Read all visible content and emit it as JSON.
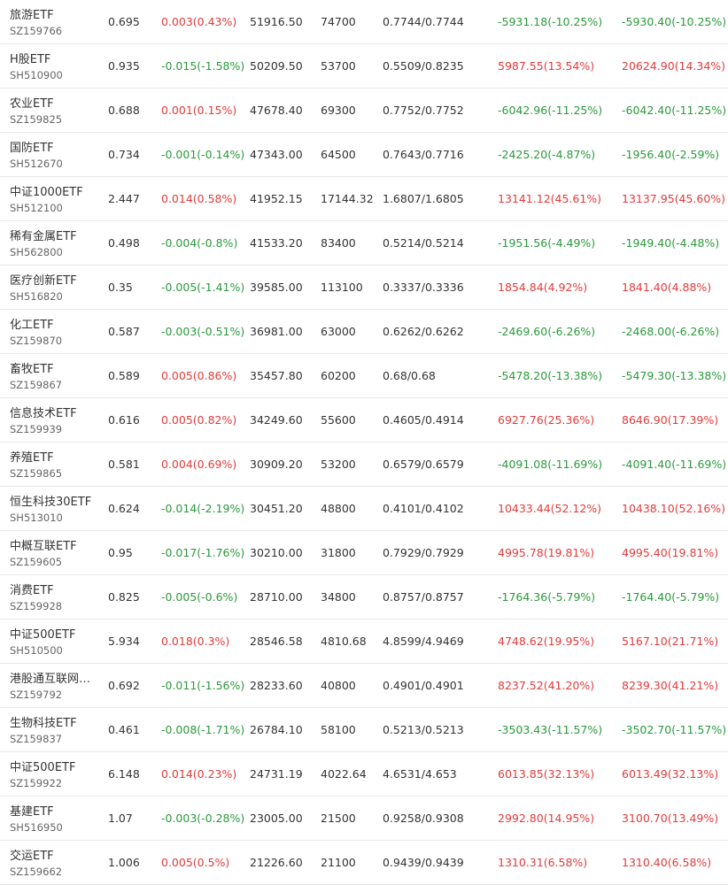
{
  "colors": {
    "up": "#e33b3b",
    "down": "#2a9a3c"
  },
  "rows": [
    {
      "name": "旅游ETF",
      "code": "SZ159766",
      "price": "0.695",
      "change": "0.003(0.43%)",
      "change_dir": "up",
      "market_value": "51916.50",
      "quantity": "74700",
      "cost": "0.7744/0.7744",
      "profit": "-5931.18(-10.25%)",
      "profit_dir": "down",
      "profit2": "-5930.40(-10.25%)",
      "profit2_dir": "down"
    },
    {
      "name": "H股ETF",
      "code": "SH510900",
      "price": "0.935",
      "change": "-0.015(-1.58%)",
      "change_dir": "down",
      "market_value": "50209.50",
      "quantity": "53700",
      "cost": "0.5509/0.8235",
      "profit": "5987.55(13.54%)",
      "profit_dir": "up",
      "profit2": "20624.90(14.34%)",
      "profit2_dir": "up"
    },
    {
      "name": "农业ETF",
      "code": "SZ159825",
      "price": "0.688",
      "change": "0.001(0.15%)",
      "change_dir": "up",
      "market_value": "47678.40",
      "quantity": "69300",
      "cost": "0.7752/0.7752",
      "profit": "-6042.96(-11.25%)",
      "profit_dir": "down",
      "profit2": "-6042.40(-11.25%)",
      "profit2_dir": "down"
    },
    {
      "name": "国防ETF",
      "code": "SH512670",
      "price": "0.734",
      "change": "-0.001(-0.14%)",
      "change_dir": "down",
      "market_value": "47343.00",
      "quantity": "64500",
      "cost": "0.7643/0.7716",
      "profit": "-2425.20(-4.87%)",
      "profit_dir": "down",
      "profit2": "-1956.40(-2.59%)",
      "profit2_dir": "down"
    },
    {
      "name": "中证1000ETF",
      "code": "SH512100",
      "price": "2.447",
      "change": "0.014(0.58%)",
      "change_dir": "up",
      "market_value": "41952.15",
      "quantity": "17144.32",
      "cost": "1.6807/1.6805",
      "profit": "13141.12(45.61%)",
      "profit_dir": "up",
      "profit2": "13137.95(45.60%)",
      "profit2_dir": "up"
    },
    {
      "name": "稀有金属ETF",
      "code": "SH562800",
      "price": "0.498",
      "change": "-0.004(-0.8%)",
      "change_dir": "down",
      "market_value": "41533.20",
      "quantity": "83400",
      "cost": "0.5214/0.5214",
      "profit": "-1951.56(-4.49%)",
      "profit_dir": "down",
      "profit2": "-1949.40(-4.48%)",
      "profit2_dir": "down"
    },
    {
      "name": "医疗创新ETF",
      "code": "SH516820",
      "price": "0.35",
      "change": "-0.005(-1.41%)",
      "change_dir": "down",
      "market_value": "39585.00",
      "quantity": "113100",
      "cost": "0.3337/0.3336",
      "profit": "1854.84(4.92%)",
      "profit_dir": "up",
      "profit2": "1841.40(4.88%)",
      "profit2_dir": "up"
    },
    {
      "name": "化工ETF",
      "code": "SZ159870",
      "price": "0.587",
      "change": "-0.003(-0.51%)",
      "change_dir": "down",
      "market_value": "36981.00",
      "quantity": "63000",
      "cost": "0.6262/0.6262",
      "profit": "-2469.60(-6.26%)",
      "profit_dir": "down",
      "profit2": "-2468.00(-6.26%)",
      "profit2_dir": "down"
    },
    {
      "name": "畜牧ETF",
      "code": "SZ159867",
      "price": "0.589",
      "change": "0.005(0.86%)",
      "change_dir": "up",
      "market_value": "35457.80",
      "quantity": "60200",
      "cost": "0.68/0.68",
      "profit": "-5478.20(-13.38%)",
      "profit_dir": "down",
      "profit2": "-5479.30(-13.38%)",
      "profit2_dir": "down"
    },
    {
      "name": "信息技术ETF",
      "code": "SZ159939",
      "price": "0.616",
      "change": "0.005(0.82%)",
      "change_dir": "up",
      "market_value": "34249.60",
      "quantity": "55600",
      "cost": "0.4605/0.4914",
      "profit": "6927.76(25.36%)",
      "profit_dir": "up",
      "profit2": "8646.90(17.39%)",
      "profit2_dir": "up"
    },
    {
      "name": "养殖ETF",
      "code": "SZ159865",
      "price": "0.581",
      "change": "0.004(0.69%)",
      "change_dir": "up",
      "market_value": "30909.20",
      "quantity": "53200",
      "cost": "0.6579/0.6579",
      "profit": "-4091.08(-11.69%)",
      "profit_dir": "down",
      "profit2": "-4091.40(-11.69%)",
      "profit2_dir": "down"
    },
    {
      "name": "恒生科技30ETF",
      "code": "SH513010",
      "price": "0.624",
      "change": "-0.014(-2.19%)",
      "change_dir": "down",
      "market_value": "30451.20",
      "quantity": "48800",
      "cost": "0.4101/0.4102",
      "profit": "10433.44(52.12%)",
      "profit_dir": "up",
      "profit2": "10438.10(52.16%)",
      "profit2_dir": "up"
    },
    {
      "name": "中概互联ETF",
      "code": "SZ159605",
      "price": "0.95",
      "change": "-0.017(-1.76%)",
      "change_dir": "down",
      "market_value": "30210.00",
      "quantity": "31800",
      "cost": "0.7929/0.7929",
      "profit": "4995.78(19.81%)",
      "profit_dir": "up",
      "profit2": "4995.40(19.81%)",
      "profit2_dir": "up"
    },
    {
      "name": "消费ETF",
      "code": "SZ159928",
      "price": "0.825",
      "change": "-0.005(-0.6%)",
      "change_dir": "down",
      "market_value": "28710.00",
      "quantity": "34800",
      "cost": "0.8757/0.8757",
      "profit": "-1764.36(-5.79%)",
      "profit_dir": "down",
      "profit2": "-1764.40(-5.79%)",
      "profit2_dir": "down"
    },
    {
      "name": "中证500ETF",
      "code": "SH510500",
      "price": "5.934",
      "change": "0.018(0.3%)",
      "change_dir": "up",
      "market_value": "28546.58",
      "quantity": "4810.68",
      "cost": "4.8599/4.9469",
      "profit": "4748.62(19.95%)",
      "profit_dir": "up",
      "profit2": "5167.10(21.71%)",
      "profit2_dir": "up"
    },
    {
      "name": "港股通互联网…",
      "code": "SZ159792",
      "price": "0.692",
      "change": "-0.011(-1.56%)",
      "change_dir": "down",
      "market_value": "28233.60",
      "quantity": "40800",
      "cost": "0.4901/0.4901",
      "profit": "8237.52(41.20%)",
      "profit_dir": "up",
      "profit2": "8239.30(41.21%)",
      "profit2_dir": "up"
    },
    {
      "name": "生物科技ETF",
      "code": "SZ159837",
      "price": "0.461",
      "change": "-0.008(-1.71%)",
      "change_dir": "down",
      "market_value": "26784.10",
      "quantity": "58100",
      "cost": "0.5213/0.5213",
      "profit": "-3503.43(-11.57%)",
      "profit_dir": "down",
      "profit2": "-3502.70(-11.57%)",
      "profit2_dir": "down"
    },
    {
      "name": "中证500ETF",
      "code": "SZ159922",
      "price": "6.148",
      "change": "0.014(0.23%)",
      "change_dir": "up",
      "market_value": "24731.19",
      "quantity": "4022.64",
      "cost": "4.6531/4.653",
      "profit": "6013.85(32.13%)",
      "profit_dir": "up",
      "profit2": "6013.49(32.13%)",
      "profit2_dir": "up"
    },
    {
      "name": "基建ETF",
      "code": "SH516950",
      "price": "1.07",
      "change": "-0.003(-0.28%)",
      "change_dir": "down",
      "market_value": "23005.00",
      "quantity": "21500",
      "cost": "0.9258/0.9308",
      "profit": "2992.80(14.95%)",
      "profit_dir": "up",
      "profit2": "3100.70(13.49%)",
      "profit2_dir": "up"
    },
    {
      "name": "交运ETF",
      "code": "SZ159662",
      "price": "1.006",
      "change": "0.005(0.5%)",
      "change_dir": "up",
      "market_value": "21226.60",
      "quantity": "21100",
      "cost": "0.9439/0.9439",
      "profit": "1310.31(6.58%)",
      "profit_dir": "up",
      "profit2": "1310.40(6.58%)",
      "profit2_dir": "up"
    }
  ]
}
